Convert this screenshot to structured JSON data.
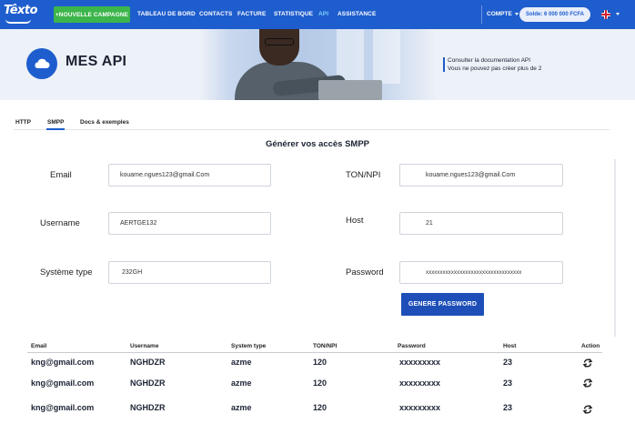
{
  "nav": {
    "logo_text": "Têxto",
    "campaign_button": "+NOUVELLE CAMPAGNE",
    "items": [
      "TABLEAU DE BORD",
      "CONTACTS",
      "FACTURE",
      "STATISTIQUE",
      "API",
      "ASSISTANCE"
    ],
    "active_item": "API",
    "compte": "COMPTE",
    "solde": "Solde: 6 000 000 FCFA",
    "language_icon": "uk-flag-icon"
  },
  "banner": {
    "title": "MES API",
    "icon": "cloud-icon",
    "note_line1": "Consulter la documentation API",
    "note_line2": "Vous ne pouvez pas créer plus de 2"
  },
  "tabs": [
    "HTTP",
    "SMPP",
    "Docs & exemples"
  ],
  "active_tab": "SMPP",
  "section_title": "Générer vos accès SMPP",
  "form": {
    "email_label": "Email",
    "email_value": "kouame.ngues123@gmail.Com",
    "ton_label": "TON/NPI",
    "ton_value": "kouame.ngues123@gmail.Com",
    "username_label": "Username",
    "username_value": "AERTGE132",
    "host_label": "Host",
    "host_value": "21",
    "systeme_label": "Système type",
    "systeme_value": "232GH",
    "password_label": "Password",
    "password_value": "xxxxxxxxxxxxxxxxxxxxxxxxxxxxxxxxxx",
    "generate_button": "GENERE PASSWORD"
  },
  "table": {
    "headers": [
      "Email",
      "Username",
      "System type",
      "TON/NPI",
      "Password",
      "Host",
      "Action"
    ],
    "rows": [
      [
        "kng@gmail.com",
        "NGHDZR",
        "azme",
        "120",
        "xxxxxxxxx",
        "23"
      ],
      [
        "kng@gmail.com",
        "NGHDZR",
        "azme",
        "120",
        "xxxxxxxxx",
        "23"
      ],
      [
        "kng@gmail.com",
        "NGHDZR",
        "azme",
        "120",
        "xxxxxxxxx",
        "23"
      ]
    ],
    "action_icon": "refresh-icon"
  },
  "colors": {
    "primary": "#1e5dcd",
    "campaign_green": "#3cb54a",
    "active_nav": "#7fd3ff"
  }
}
